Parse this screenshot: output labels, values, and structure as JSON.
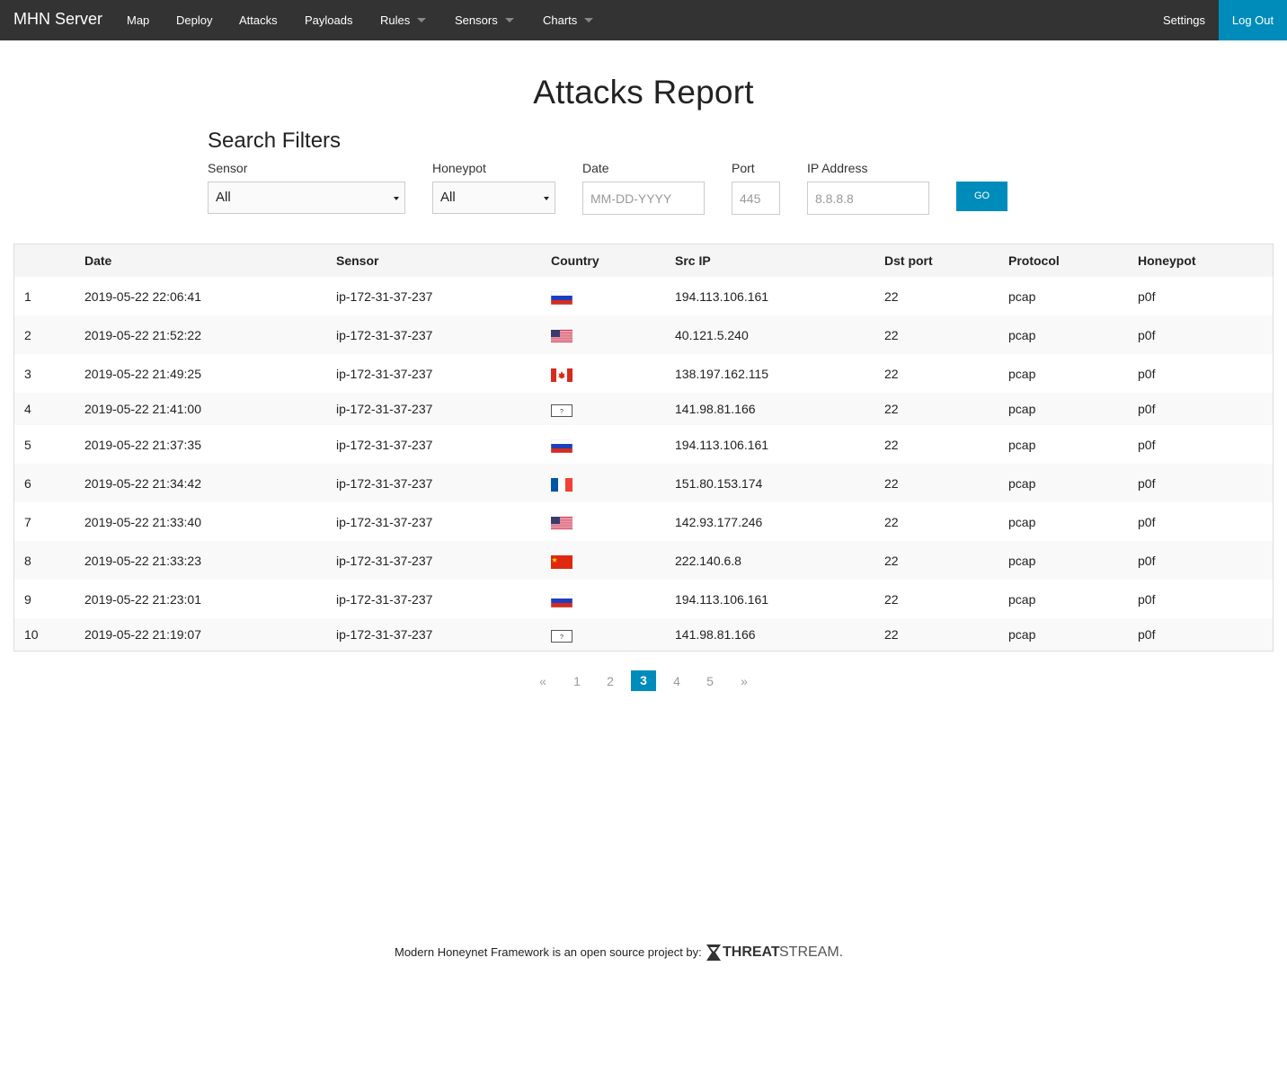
{
  "nav": {
    "brand": "MHN Server",
    "items": [
      {
        "label": "Map",
        "dropdown": false
      },
      {
        "label": "Deploy",
        "dropdown": false
      },
      {
        "label": "Attacks",
        "dropdown": false
      },
      {
        "label": "Payloads",
        "dropdown": false
      },
      {
        "label": "Rules",
        "dropdown": true
      },
      {
        "label": "Sensors",
        "dropdown": true
      },
      {
        "label": "Charts",
        "dropdown": true
      }
    ],
    "settings": "Settings",
    "logout": "Log Out"
  },
  "page_title": "Attacks Report",
  "filters": {
    "title": "Search Filters",
    "sensor": {
      "label": "Sensor",
      "value": "All"
    },
    "honeypot": {
      "label": "Honeypot",
      "value": "All"
    },
    "date": {
      "label": "Date",
      "placeholder": "MM-DD-YYYY"
    },
    "port": {
      "label": "Port",
      "placeholder": "445"
    },
    "ip": {
      "label": "IP Address",
      "placeholder": "8.8.8.8"
    },
    "go": "GO"
  },
  "table": {
    "headers": [
      "",
      "Date",
      "Sensor",
      "Country",
      "Src IP",
      "Dst port",
      "Protocol",
      "Honeypot"
    ],
    "rows": [
      {
        "num": "1",
        "date": "2019-05-22 22:06:41",
        "sensor": "ip-172-31-37-237",
        "country": "ru",
        "src_ip": "194.113.106.161",
        "dst_port": "22",
        "protocol": "pcap",
        "honeypot": "p0f"
      },
      {
        "num": "2",
        "date": "2019-05-22 21:52:22",
        "sensor": "ip-172-31-37-237",
        "country": "us",
        "src_ip": "40.121.5.240",
        "dst_port": "22",
        "protocol": "pcap",
        "honeypot": "p0f"
      },
      {
        "num": "3",
        "date": "2019-05-22 21:49:25",
        "sensor": "ip-172-31-37-237",
        "country": "ca",
        "src_ip": "138.197.162.115",
        "dst_port": "22",
        "protocol": "pcap",
        "honeypot": "p0f"
      },
      {
        "num": "4",
        "date": "2019-05-22 21:41:00",
        "sensor": "ip-172-31-37-237",
        "country": "unknown",
        "src_ip": "141.98.81.166",
        "dst_port": "22",
        "protocol": "pcap",
        "honeypot": "p0f"
      },
      {
        "num": "5",
        "date": "2019-05-22 21:37:35",
        "sensor": "ip-172-31-37-237",
        "country": "ru",
        "src_ip": "194.113.106.161",
        "dst_port": "22",
        "protocol": "pcap",
        "honeypot": "p0f"
      },
      {
        "num": "6",
        "date": "2019-05-22 21:34:42",
        "sensor": "ip-172-31-37-237",
        "country": "fr",
        "src_ip": "151.80.153.174",
        "dst_port": "22",
        "protocol": "pcap",
        "honeypot": "p0f"
      },
      {
        "num": "7",
        "date": "2019-05-22 21:33:40",
        "sensor": "ip-172-31-37-237",
        "country": "us",
        "src_ip": "142.93.177.246",
        "dst_port": "22",
        "protocol": "pcap",
        "honeypot": "p0f"
      },
      {
        "num": "8",
        "date": "2019-05-22 21:33:23",
        "sensor": "ip-172-31-37-237",
        "country": "cn",
        "src_ip": "222.140.6.8",
        "dst_port": "22",
        "protocol": "pcap",
        "honeypot": "p0f"
      },
      {
        "num": "9",
        "date": "2019-05-22 21:23:01",
        "sensor": "ip-172-31-37-237",
        "country": "ru",
        "src_ip": "194.113.106.161",
        "dst_port": "22",
        "protocol": "pcap",
        "honeypot": "p0f"
      },
      {
        "num": "10",
        "date": "2019-05-22 21:19:07",
        "sensor": "ip-172-31-37-237",
        "country": "unknown",
        "src_ip": "141.98.81.166",
        "dst_port": "22",
        "protocol": "pcap",
        "honeypot": "p0f"
      }
    ]
  },
  "pagination": {
    "prev": "«",
    "pages": [
      "1",
      "2",
      "3",
      "4",
      "5"
    ],
    "current": "3",
    "next": "»"
  },
  "footer": {
    "text": "Modern Honeynet Framework is an open source project by:",
    "logo_bold": "THREAT",
    "logo_light": "STREAM."
  },
  "colors": {
    "navbar": "#333333",
    "accent": "#008cba"
  }
}
